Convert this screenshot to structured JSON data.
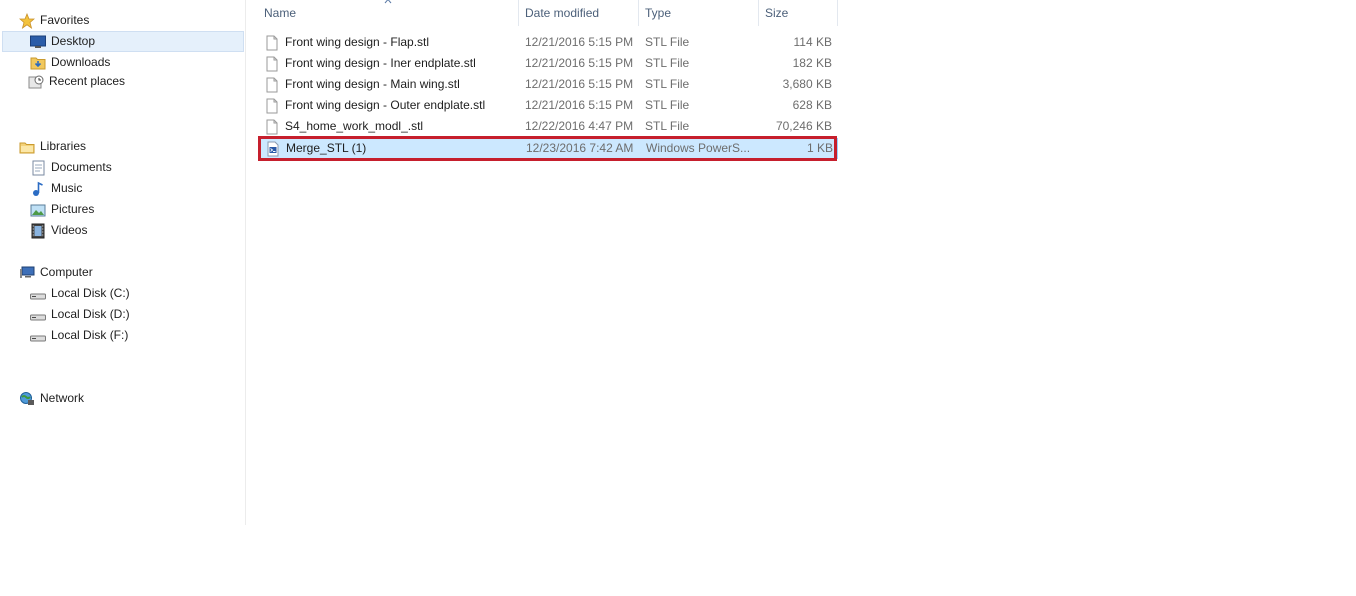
{
  "nav": {
    "favorites": {
      "label": "Favorites",
      "items": [
        {
          "label": "Desktop",
          "icon": "desktop-icon",
          "selected": true
        },
        {
          "label": "Downloads",
          "icon": "downloads-folder-icon"
        },
        {
          "label": "Recent places",
          "icon": "recent-places-icon"
        }
      ]
    },
    "libraries": {
      "label": "Libraries",
      "items": [
        {
          "label": "Documents",
          "icon": "documents-icon"
        },
        {
          "label": "Music",
          "icon": "music-icon"
        },
        {
          "label": "Pictures",
          "icon": "pictures-icon"
        },
        {
          "label": "Videos",
          "icon": "videos-icon"
        }
      ]
    },
    "computer": {
      "label": "Computer",
      "items": [
        {
          "label": "Local Disk (C:)",
          "icon": "drive-icon"
        },
        {
          "label": "Local Disk (D:)",
          "icon": "drive-icon"
        },
        {
          "label": "Local Disk (F:)",
          "icon": "drive-icon"
        }
      ]
    },
    "network": {
      "label": "Network",
      "icon": "network-icon"
    }
  },
  "file_list": {
    "columns": {
      "name": "Name",
      "date_modified": "Date modified",
      "type": "Type",
      "size": "Size"
    },
    "sort_column": "name",
    "rows": [
      {
        "name": "Front wing design - Flap.stl",
        "date": "12/21/2016 5:15 PM",
        "type": "STL File",
        "size": "114 KB",
        "icon": "stl-file-icon"
      },
      {
        "name": "Front wing design - Iner endplate.stl",
        "date": "12/21/2016 5:15 PM",
        "type": "STL File",
        "size": "182 KB",
        "icon": "stl-file-icon"
      },
      {
        "name": "Front wing design - Main wing.stl",
        "date": "12/21/2016 5:15 PM",
        "type": "STL File",
        "size": "3,680 KB",
        "icon": "stl-file-icon"
      },
      {
        "name": "Front wing design - Outer endplate.stl",
        "date": "12/21/2016 5:15 PM",
        "type": "STL File",
        "size": "628 KB",
        "icon": "stl-file-icon"
      },
      {
        "name": "S4_home_work_modl_.stl",
        "date": "12/22/2016 4:47 PM",
        "type": "STL File",
        "size": "70,246 KB",
        "icon": "stl-file-icon"
      },
      {
        "name": "Merge_STL (1)",
        "date": "12/23/2016 7:42 AM",
        "type": "Windows PowerS...",
        "size": "1 KB",
        "icon": "powershell-script-icon",
        "selected": true,
        "highlighted": true
      }
    ]
  },
  "colors": {
    "selection_fill": "#cce8ff",
    "selection_border": "#99d1ff",
    "highlight_frame": "#c61f2d",
    "header_text": "#4c607a"
  }
}
